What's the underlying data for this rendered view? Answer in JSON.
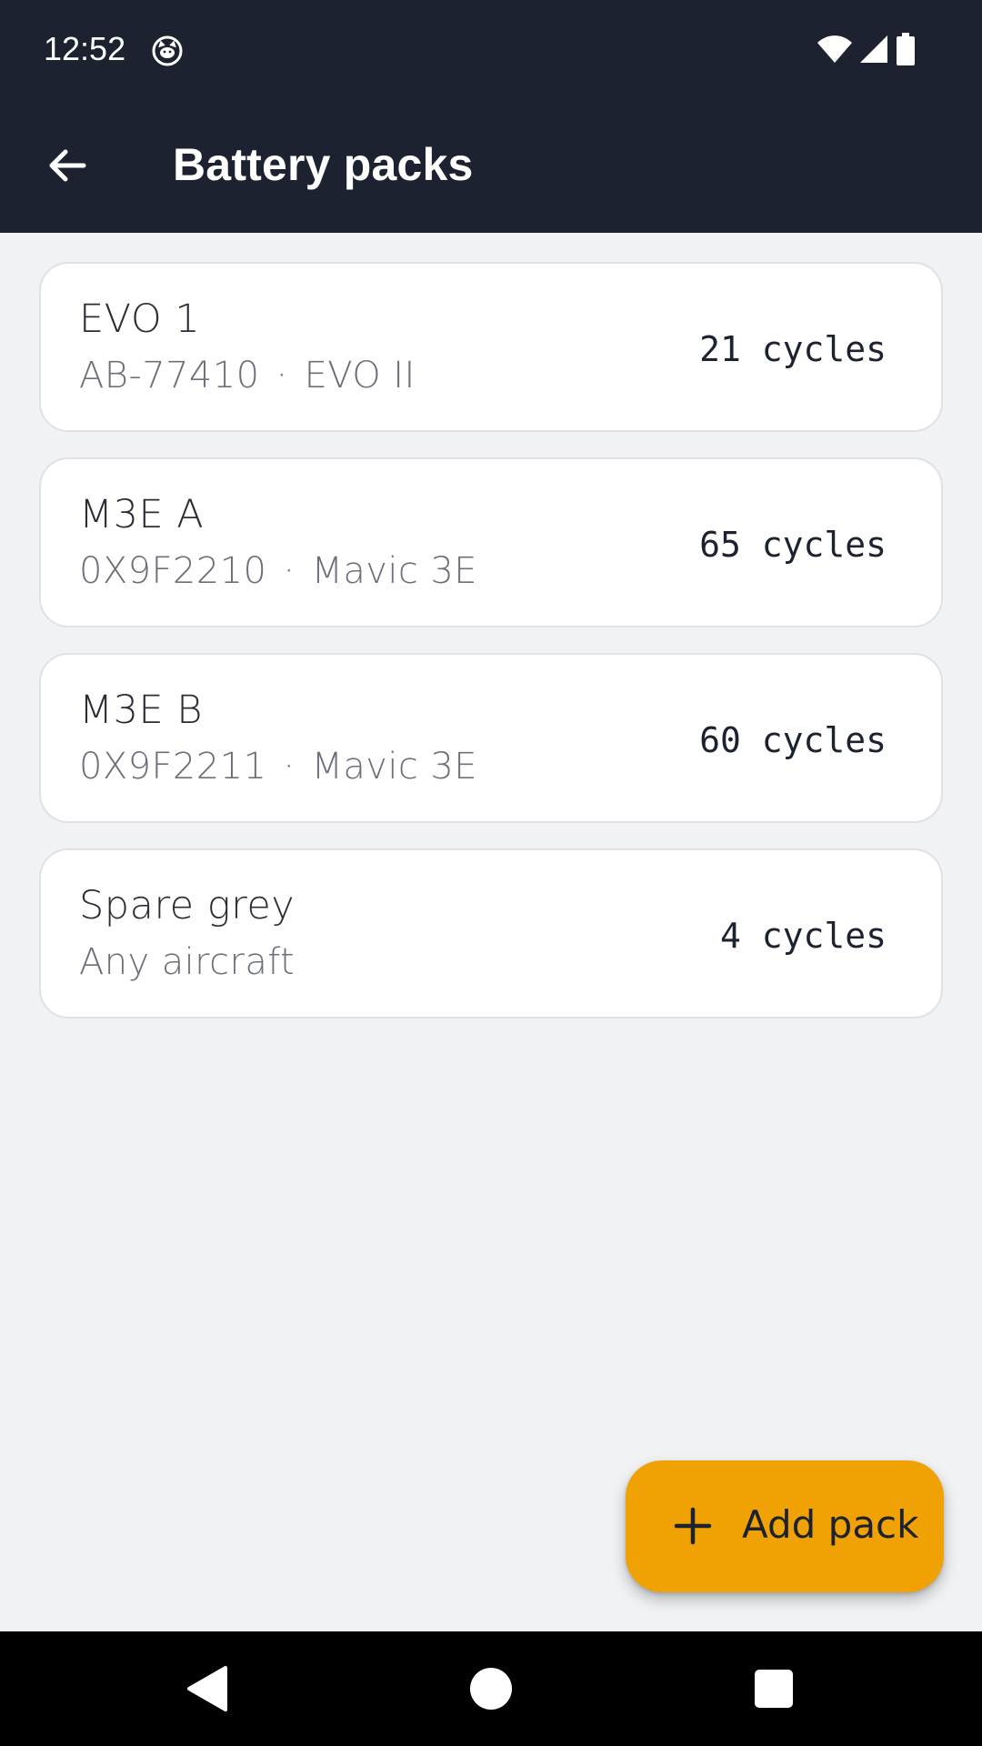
{
  "status_bar": {
    "time": "12:52",
    "app_icon": "cat-face-icon",
    "icons": [
      "wifi-icon",
      "cellular-signal-icon",
      "battery-icon"
    ]
  },
  "app_bar": {
    "back_icon": "arrow-left-icon",
    "title": "Battery packs"
  },
  "packs": [
    {
      "name": "EVO 1",
      "serial": "AB-77410",
      "separator": "·",
      "aircraft": "EVO II",
      "cycles": "21 cycles"
    },
    {
      "name": "M3E A",
      "serial": "0X9F2210",
      "separator": "·",
      "aircraft": "Mavic 3E",
      "cycles": "65 cycles"
    },
    {
      "name": "M3E B",
      "serial": "0X9F2211",
      "separator": "·",
      "aircraft": "Mavic 3E",
      "cycles": "60 cycles"
    },
    {
      "name": "Spare grey",
      "serial": "",
      "separator": "",
      "aircraft": "Any aircraft",
      "cycles": "4 cycles"
    }
  ],
  "fab": {
    "icon": "plus-icon",
    "label": "Add pack"
  },
  "nav_bar": {
    "buttons": [
      "back-triangle-icon",
      "home-circle-icon",
      "recents-square-icon"
    ]
  },
  "colors": {
    "app_bar": "#1d2231",
    "background": "#f1f2f4",
    "card": "#ffffff",
    "accent": "#f0a104"
  }
}
